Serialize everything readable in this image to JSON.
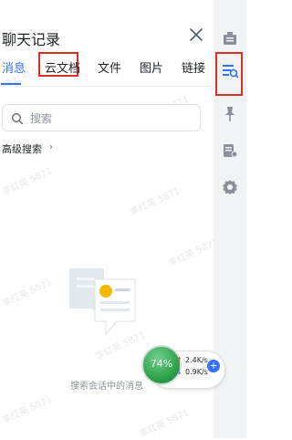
{
  "panel": {
    "title": "聊天记录",
    "close_icon": "close-icon"
  },
  "tabs": [
    {
      "label": "消息",
      "active": true
    },
    {
      "label": "云文档",
      "active": false,
      "highlighted": true
    },
    {
      "label": "文件",
      "active": false
    },
    {
      "label": "图片",
      "active": false
    },
    {
      "label": "链接",
      "active": false
    }
  ],
  "search": {
    "placeholder": "搜索",
    "icon": "search-icon"
  },
  "advanced_search": {
    "label": "高级搜索",
    "chevron": "›"
  },
  "empty_state": {
    "message": "搜索会话中的消息"
  },
  "right_rail": {
    "items": [
      {
        "icon": "group-announcement-icon",
        "highlighted": false
      },
      {
        "icon": "search-history-icon",
        "highlighted": true
      },
      {
        "icon": "pin-icon",
        "highlighted": false
      },
      {
        "icon": "group-settings-icon",
        "highlighted": false
      },
      {
        "icon": "gear-icon",
        "highlighted": false
      }
    ]
  },
  "network_monitor": {
    "percent": "74%",
    "upload": "2.4K/s",
    "download": "0.9K/s"
  },
  "watermark": {
    "text": "李红英 5871"
  },
  "colors": {
    "accent": "#3370ff",
    "highlight_border": "#d93026",
    "rail_bg": "#f2f3f5"
  }
}
